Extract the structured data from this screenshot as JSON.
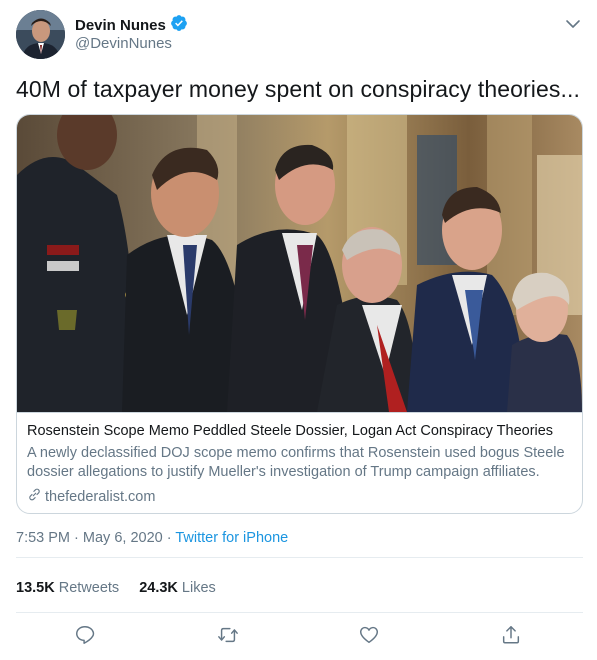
{
  "author": {
    "name": "Devin Nunes",
    "handle": "@DevinNunes",
    "verified": true
  },
  "tweet": {
    "text": "40M of taxpayer money spent on conspiracy theories..."
  },
  "card": {
    "title": "Rosenstein Scope Memo Peddled Steele Dossier, Logan Act Conspiracy Theories",
    "description": "A newly declassified DOJ scope memo confirms that Rosenstein used bogus Steele dossier allegations to justify Mueller's investigation of Trump campaign affiliates.",
    "domain": "thefederalist.com"
  },
  "meta": {
    "time": "7:53 PM",
    "separator": "·",
    "date": "May 6, 2020",
    "source": "Twitter for iPhone"
  },
  "stats": {
    "retweets_count": "13.5K",
    "retweets_label": "Retweets",
    "likes_count": "24.3K",
    "likes_label": "Likes"
  },
  "icons": {
    "verified": "verified-badge-icon",
    "menu": "chevron-down-icon",
    "link": "link-icon",
    "reply": "reply-icon",
    "retweet": "retweet-icon",
    "like": "heart-icon",
    "share": "share-icon"
  },
  "colors": {
    "accent": "#1b95e0",
    "secondary_text": "#657786",
    "border": "#ccd6dd"
  }
}
